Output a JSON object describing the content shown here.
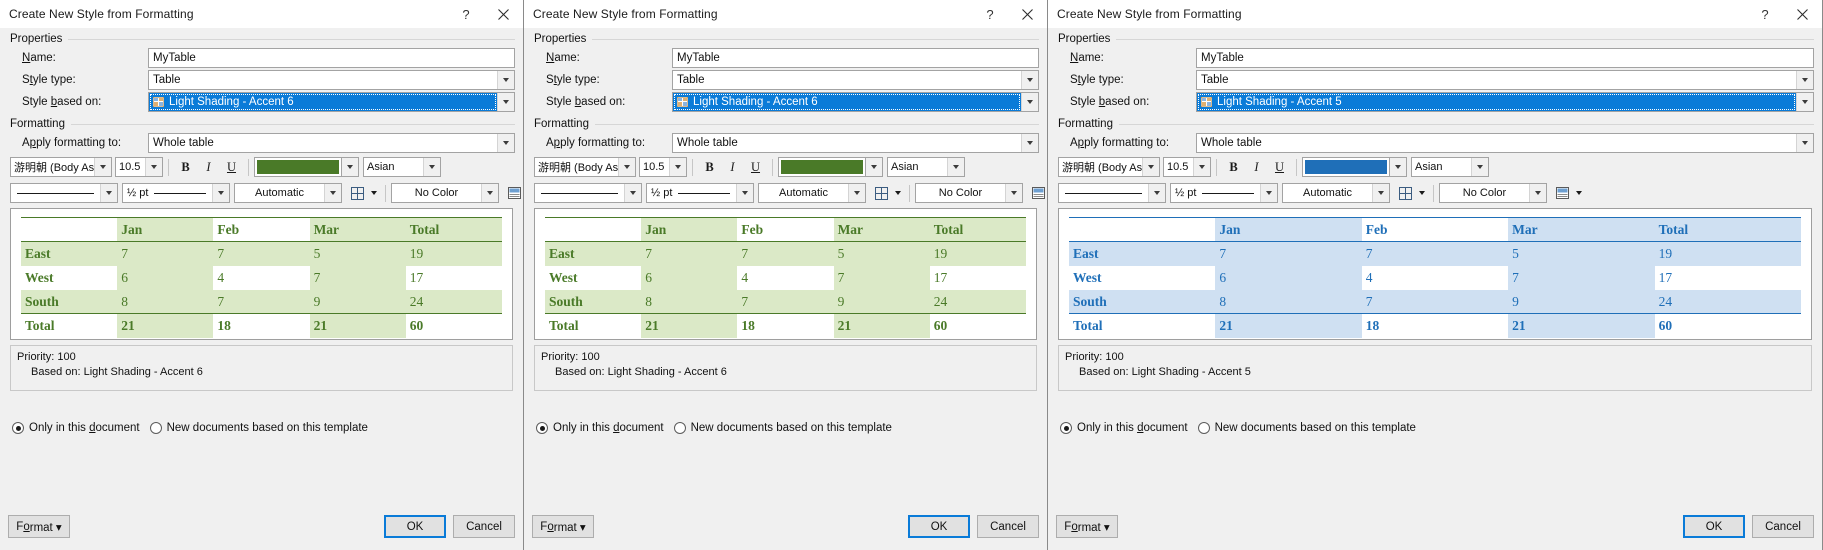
{
  "dialogs": [
    {
      "id": "panel-1",
      "title": "Create New Style from Formatting",
      "titlebar": {
        "help": "?",
        "close": "✕"
      },
      "groups": {
        "properties": "Properties",
        "formatting": "Formatting"
      },
      "fields": {
        "name_label": "Name:",
        "name_value": "MyTable",
        "style_type_label": "Style type:",
        "style_type_value": "Table",
        "style_based_label": "Style based on:",
        "style_based_value": "Light Shading - Accent 6",
        "apply_to_label": "Apply formatting to:",
        "apply_to_value": "Whole table"
      },
      "toolbar": {
        "font_name": "游明朝 (Body Asia",
        "font_size": "10.5",
        "bold": "B",
        "italic": "I",
        "underline": "U",
        "font_color": "#4a7a28",
        "language": "Asian",
        "border_style": "",
        "border_width": "½ pt",
        "border_color": "Automatic",
        "shading": "No Color"
      },
      "accent": "#4a7a28",
      "band": "#dbe9c7",
      "preview": {
        "columns": [
          "",
          "Jan",
          "Feb",
          "Mar",
          "Total"
        ],
        "rows": [
          {
            "label": "East",
            "values": [
              "7",
              "7",
              "5",
              "19"
            ]
          },
          {
            "label": "West",
            "values": [
              "6",
              "4",
              "7",
              "17"
            ]
          },
          {
            "label": "South",
            "values": [
              "8",
              "7",
              "9",
              "24"
            ]
          }
        ],
        "total": {
          "label": "Total",
          "values": [
            "21",
            "18",
            "21",
            "60"
          ]
        }
      },
      "description": {
        "priority": "Priority: 100",
        "based_on": "Based on: Light Shading - Accent 6"
      },
      "radios": {
        "only_this_document": "Only in this document",
        "new_documents": "New documents based on this template",
        "selected": "only_this_document"
      },
      "buttons": {
        "format": "Format",
        "ok": "OK",
        "cancel": "Cancel"
      }
    },
    {
      "id": "panel-2",
      "title": "Create New Style from Formatting",
      "titlebar": {
        "help": "?",
        "close": "✕"
      },
      "groups": {
        "properties": "Properties",
        "formatting": "Formatting"
      },
      "fields": {
        "name_label": "Name:",
        "name_value": "MyTable",
        "style_type_label": "Style type:",
        "style_type_value": "Table",
        "style_based_label": "Style based on:",
        "style_based_value": "Light Shading - Accent 6",
        "apply_to_label": "Apply formatting to:",
        "apply_to_value": "Whole table"
      },
      "toolbar": {
        "font_name": "游明朝 (Body Asia",
        "font_size": "10.5",
        "bold": "B",
        "italic": "I",
        "underline": "U",
        "font_color": "#4a7a28",
        "language": "Asian",
        "border_style": "",
        "border_width": "½ pt",
        "border_color": "Automatic",
        "shading": "No Color"
      },
      "accent": "#4a7a28",
      "band": "#dbe9c7",
      "preview": {
        "columns": [
          "",
          "Jan",
          "Feb",
          "Mar",
          "Total"
        ],
        "rows": [
          {
            "label": "East",
            "values": [
              "7",
              "7",
              "5",
              "19"
            ]
          },
          {
            "label": "West",
            "values": [
              "6",
              "4",
              "7",
              "17"
            ]
          },
          {
            "label": "South",
            "values": [
              "8",
              "7",
              "9",
              "24"
            ]
          }
        ],
        "total": {
          "label": "Total",
          "values": [
            "21",
            "18",
            "21",
            "60"
          ]
        }
      },
      "description": {
        "priority": "Priority: 100",
        "based_on": "Based on: Light Shading - Accent 6"
      },
      "radios": {
        "only_this_document": "Only in this document",
        "new_documents": "New documents based on this template",
        "selected": "only_this_document"
      },
      "buttons": {
        "format": "Format",
        "ok": "OK",
        "cancel": "Cancel"
      }
    },
    {
      "id": "panel-3",
      "title": "Create New Style from Formatting",
      "titlebar": {
        "help": "?",
        "close": "✕"
      },
      "groups": {
        "properties": "Properties",
        "formatting": "Formatting"
      },
      "fields": {
        "name_label": "Name:",
        "name_value": "MyTable",
        "style_type_label": "Style type:",
        "style_type_value": "Table",
        "style_based_label": "Style based on:",
        "style_based_value": "Light Shading - Accent 5",
        "apply_to_label": "Apply formatting to:",
        "apply_to_value": "Whole table"
      },
      "toolbar": {
        "font_name": "游明朝 (Body Asia",
        "font_size": "10.5",
        "bold": "B",
        "italic": "I",
        "underline": "U",
        "font_color": "#1f6fb8",
        "language": "Asian",
        "border_style": "",
        "border_width": "½ pt",
        "border_color": "Automatic",
        "shading": "No Color"
      },
      "accent": "#1f6fb8",
      "band": "#cfe0f2",
      "preview": {
        "columns": [
          "",
          "Jan",
          "Feb",
          "Mar",
          "Total"
        ],
        "rows": [
          {
            "label": "East",
            "values": [
              "7",
              "7",
              "5",
              "19"
            ]
          },
          {
            "label": "West",
            "values": [
              "6",
              "4",
              "7",
              "17"
            ]
          },
          {
            "label": "South",
            "values": [
              "8",
              "7",
              "9",
              "24"
            ]
          }
        ],
        "total": {
          "label": "Total",
          "values": [
            "21",
            "18",
            "21",
            "60"
          ]
        }
      },
      "description": {
        "priority": "Priority: 100",
        "based_on": "Based on: Light Shading - Accent 5"
      },
      "radios": {
        "only_this_document": "Only in this document",
        "new_documents": "New documents based on this template",
        "selected": "only_this_document"
      },
      "buttons": {
        "format": "Format",
        "ok": "OK",
        "cancel": "Cancel"
      }
    }
  ]
}
